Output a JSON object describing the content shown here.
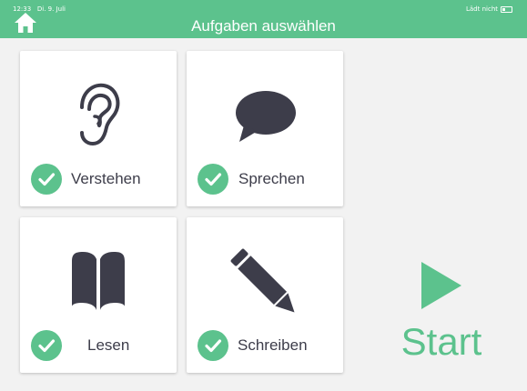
{
  "status_bar": {
    "time": "12:33",
    "date": "Di. 9. Juli",
    "charging": "Lädt nicht"
  },
  "header": {
    "title": "Aufgaben auswählen"
  },
  "cards": [
    {
      "label": "Verstehen",
      "icon": "ear-icon",
      "checked": true
    },
    {
      "label": "Sprechen",
      "icon": "speech-bubble-icon",
      "checked": true
    },
    {
      "label": "Lesen",
      "icon": "book-icon",
      "checked": true
    },
    {
      "label": "Schreiben",
      "icon": "pencil-icon",
      "checked": true
    }
  ],
  "start": {
    "label": "Start",
    "icon": "play-icon"
  },
  "colors": {
    "accent": "#5cc28d",
    "icon_dark": "#3d3d4a",
    "background": "#f2f2f2"
  }
}
